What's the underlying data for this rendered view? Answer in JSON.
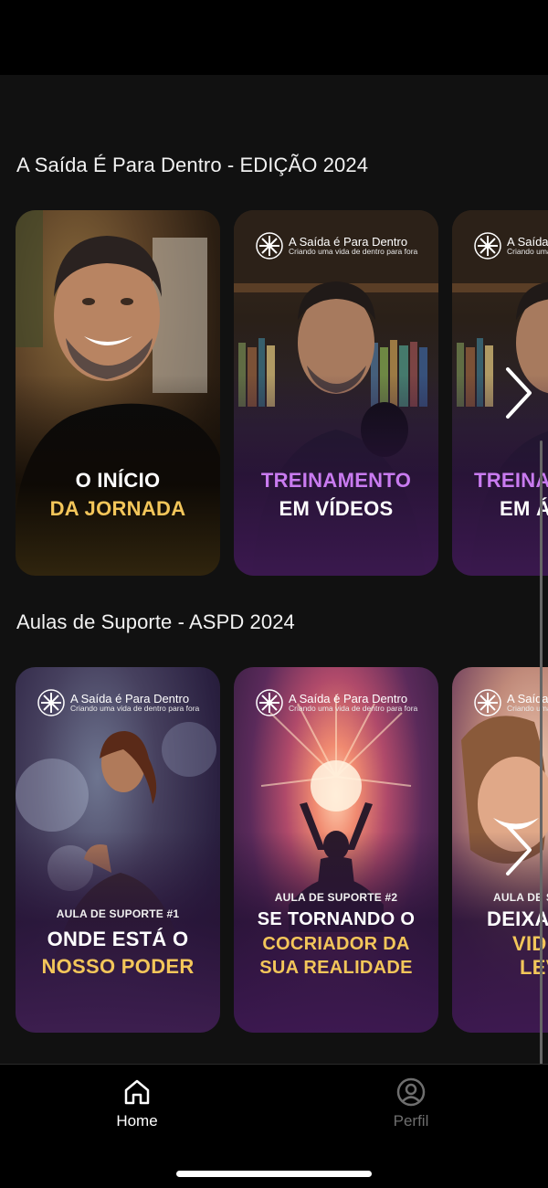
{
  "sections": [
    {
      "title": "A Saída É Para Dentro - EDIÇÃO 2024",
      "cards": [
        {
          "line1": "O INÍCIO",
          "line2": "DA JORNADA"
        },
        {
          "brand_name": "A Saída é Para Dentro",
          "brand_tagline": "Criando uma vida de dentro para fora",
          "line1": "TREINAMENTO",
          "line2": "EM VÍDEOS"
        },
        {
          "brand_name": "A Saída é Para Dentro",
          "brand_tagline": "Criando uma vida de dentro para fora",
          "line1": "TREINA",
          "line2": "EM Á"
        }
      ]
    },
    {
      "title": "Aulas de Suporte - ASPD 2024",
      "cards": [
        {
          "brand_name": "A Saída é Para Dentro",
          "brand_tagline": "Criando uma vida de dentro para fora",
          "tag": "AULA DE SUPORTE #1",
          "line1": "ONDE ESTÁ O",
          "line2": "NOSSO PODER"
        },
        {
          "brand_name": "A Saída é Para Dentro",
          "brand_tagline": "Criando uma vida de dentro para fora",
          "tag": "AULA DE SUPORTE #2",
          "line1": "SE TORNANDO O",
          "line2": "COCRIADOR DA",
          "line3": "SUA REALIDADE"
        },
        {
          "brand_name": "A Saída é Para Dentro",
          "brand_tagline": "Criando uma vida de dentro para fora",
          "tag": "AULA DE S",
          "line1": "DEIXA",
          "line2": "VID",
          "line3": "LEV"
        }
      ]
    }
  ],
  "tabs": [
    {
      "label": "Home",
      "icon": "home-icon",
      "active": true
    },
    {
      "label": "Perfil",
      "icon": "profile-icon",
      "active": false
    }
  ],
  "colors": {
    "accent_gold": "#f3c65a",
    "accent_purple": "#c97bf0",
    "background": "#111111"
  }
}
